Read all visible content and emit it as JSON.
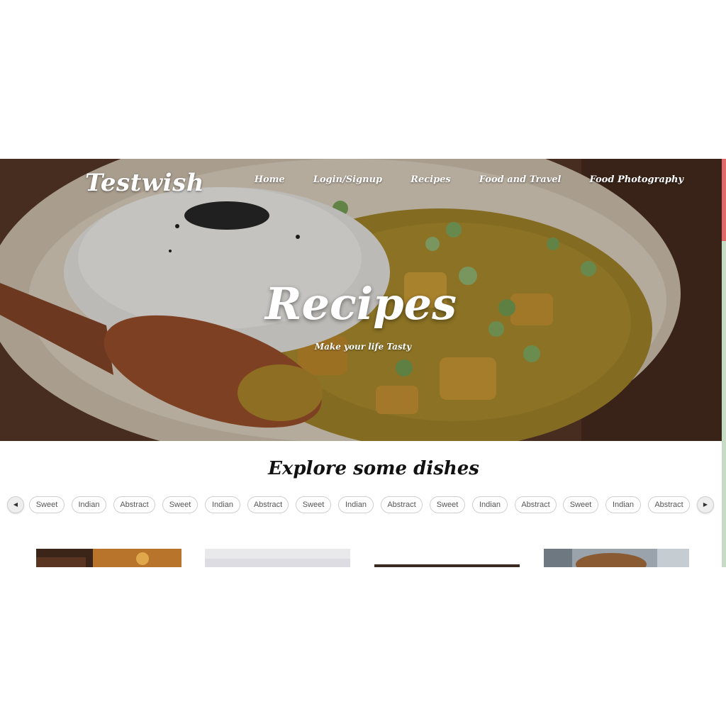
{
  "header": {
    "logo": "Testwish",
    "nav": [
      "Home",
      "Login/Signup",
      "Recipes",
      "Food and Travel",
      "Food Photography"
    ]
  },
  "hero": {
    "title": "Recipes",
    "subtitle": "Make your life Tasty"
  },
  "explore": {
    "title": "Explore some dishes",
    "chips": [
      "Sweet",
      "Indian",
      "Abstract",
      "Sweet",
      "Indian",
      "Abstract",
      "Sweet",
      "Indian",
      "Abstract",
      "Sweet",
      "Indian",
      "Abstract",
      "Sweet",
      "Indian",
      "Abstract"
    ],
    "prev_icon": "chevron-left-icon",
    "next_icon": "chevron-right-icon"
  },
  "colors": {
    "scroll_thumb": "#e06a6a",
    "scroll_track": "#c6dcc4",
    "chip_border": "#cfcfcf"
  }
}
